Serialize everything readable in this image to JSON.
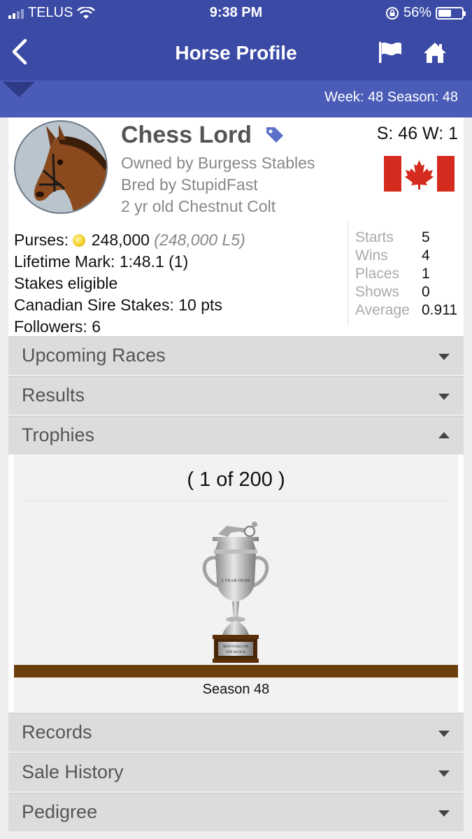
{
  "status_bar": {
    "carrier": "TELUS",
    "time": "9:38 PM",
    "battery_percent": "56%",
    "battery_level": 0.56,
    "signal_bars": 2
  },
  "nav": {
    "title": "Horse Profile",
    "back_icon": "chevron-left-icon",
    "flag_icon": "flag-icon",
    "home_icon": "home-icon"
  },
  "week_bar": {
    "text": "Week: 48  Season: 48"
  },
  "horse": {
    "name": "Chess Lord",
    "sw": "S: 46 W: 1",
    "owner": "Owned by Burgess Stables",
    "breeder": "Bred by StupidFast",
    "description": "2 yr old Chestnut Colt",
    "country_flag": "canada-flag",
    "purses_label": "Purses:",
    "purses_value": "248,000",
    "purses_l5": "(248,000 L5)",
    "lifetime_mark": "Lifetime Mark: 1:48.1 (1)",
    "stakes": "Stakes eligible",
    "sire_stakes": "Canadian Sire Stakes: 10 pts",
    "followers": "Followers: 6"
  },
  "record": [
    {
      "label": "Starts",
      "value": "5"
    },
    {
      "label": "Wins",
      "value": "4"
    },
    {
      "label": "Places",
      "value": "1"
    },
    {
      "label": "Shows",
      "value": "0"
    },
    {
      "label": "Average",
      "value": "0.911"
    }
  ],
  "sections": {
    "upcoming": "Upcoming Races",
    "results": "Results",
    "trophies": "Trophies",
    "records": "Records",
    "sale_history": "Sale History",
    "pedigree": "Pedigree"
  },
  "trophy": {
    "counter": "( 1 of 200 )",
    "cup_text": "2 YEAR OLDS",
    "plaque_text": "NEW FOALS ON THE BLOCK",
    "season": "Season 48"
  },
  "colors": {
    "nav_bg": "#3a4aa5",
    "week_bg": "#4a5bb8",
    "section_bg": "#dcdcdc",
    "shelf": "#6b3e0b"
  }
}
